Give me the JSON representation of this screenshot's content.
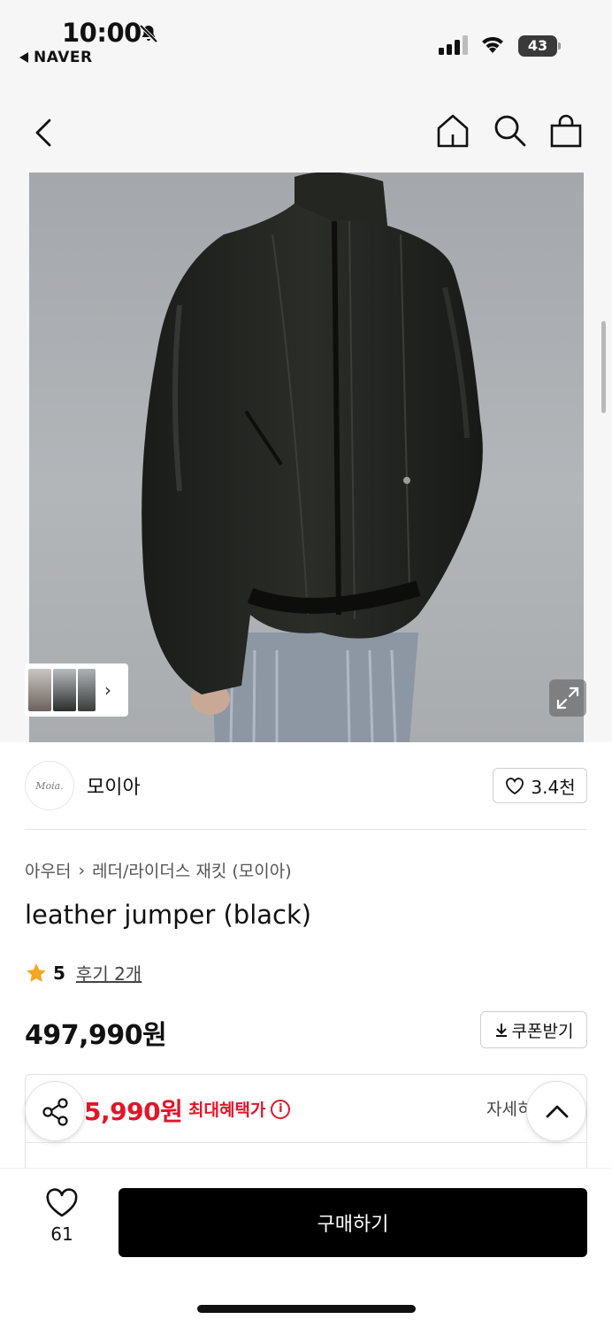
{
  "status_bar": {
    "time": "10:00",
    "back_app": "NAVER",
    "battery": "43"
  },
  "seller": {
    "logo_text": "Moia.",
    "name": "모이아",
    "likes": "3.4천"
  },
  "breadcrumb": {
    "category": "아우터",
    "subcategory": "레더/라이더스 재킷 (모이아)"
  },
  "product": {
    "title": "leather jumper (black)",
    "rating": "5",
    "reviews": "후기 2개",
    "price": "497,990원",
    "coupon_label": "쿠폰받기"
  },
  "benefit": {
    "price": "5,990원",
    "label": "최대혜택가",
    "info_symbol": "i",
    "detail": "자세히"
  },
  "bottom_bar": {
    "wish_count": "61",
    "buy_label": "구매하기"
  },
  "colors": {
    "accent_red": "#e0162b",
    "star": "#f5a623",
    "primary_button": "#000000"
  },
  "icons": [
    "bell-off-icon",
    "signal-icon",
    "wifi-icon",
    "back-icon",
    "home-icon",
    "search-icon",
    "bag-icon",
    "expand-icon",
    "heart-icon",
    "star-icon",
    "download-icon",
    "info-icon",
    "share-icon",
    "chevron-up-icon"
  ]
}
